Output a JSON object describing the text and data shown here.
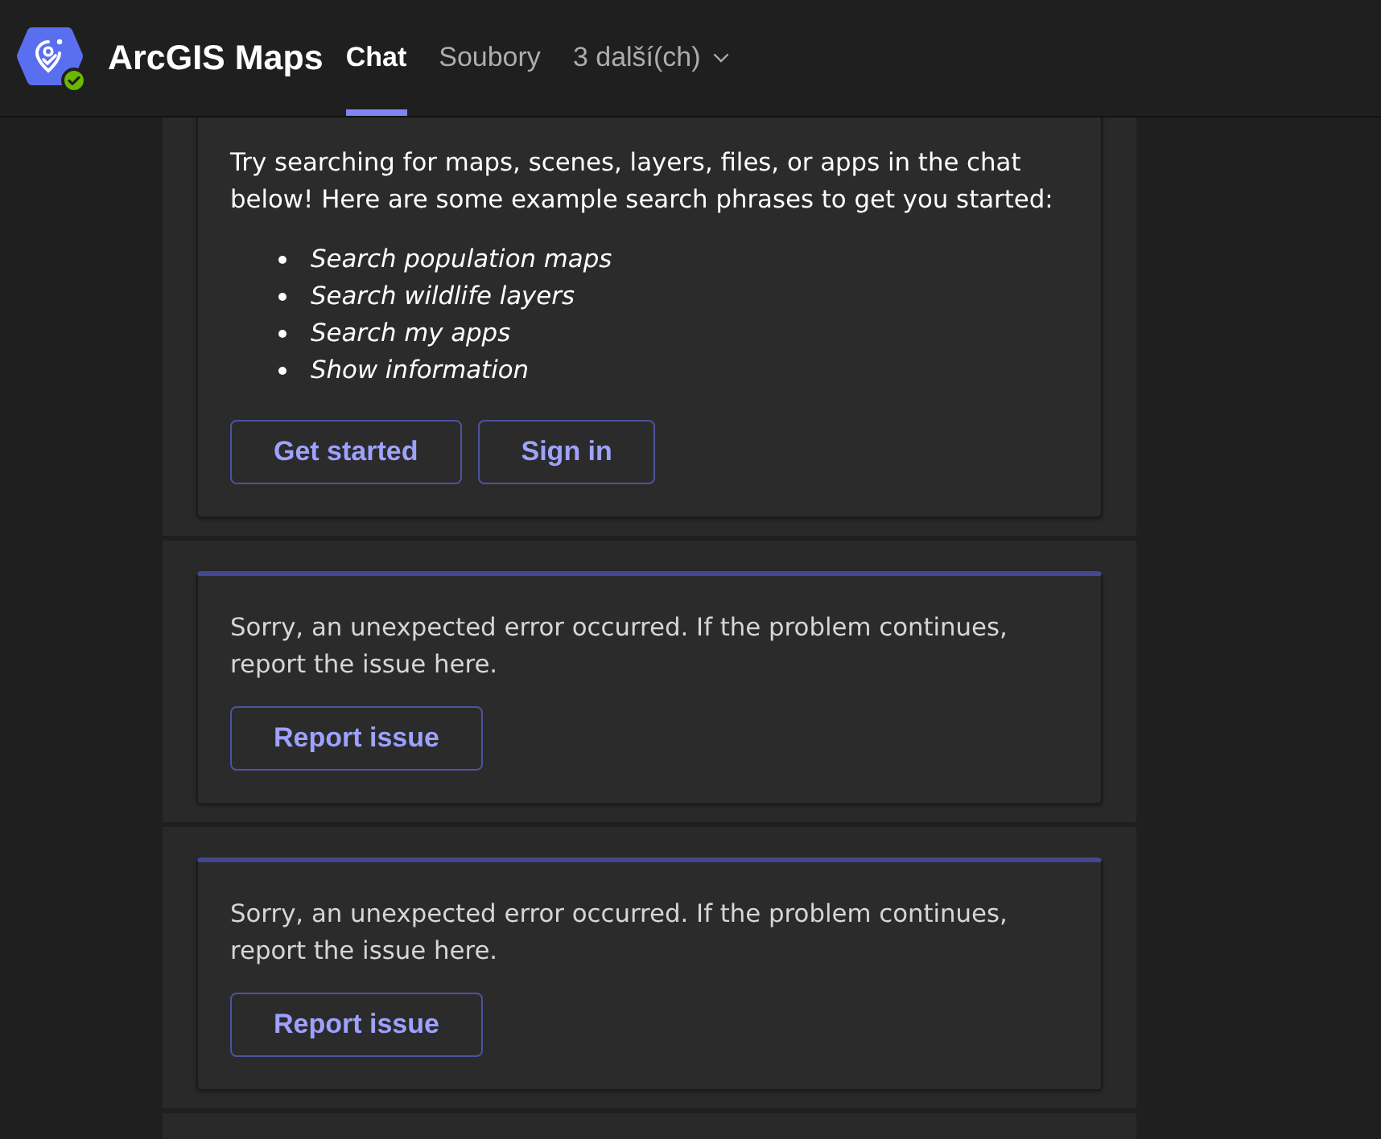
{
  "app": {
    "title": "ArcGIS Maps"
  },
  "tabs": [
    {
      "label": "Chat",
      "selected": true,
      "kind": "tab"
    },
    {
      "label": "Soubory",
      "selected": false,
      "kind": "tab"
    },
    {
      "label": "3 další(ch)",
      "selected": false,
      "kind": "menu"
    }
  ],
  "messages": [
    {
      "kind": "welcome",
      "text": "Try searching for maps, scenes, layers, files, or apps in the chat below! Here are some example search phrases to get you started:",
      "bullets": [
        "Search population maps",
        "Search wildlife layers",
        "Search my apps",
        "Show information"
      ],
      "buttons": [
        "Get started",
        "Sign in"
      ]
    },
    {
      "kind": "error",
      "text": "Sorry, an unexpected error occurred. If the problem continues, report the issue here.",
      "buttons": [
        "Report issue"
      ]
    },
    {
      "kind": "error",
      "text": "Sorry, an unexpected error occurred. If the problem continues, report the issue here.",
      "buttons": [
        "Report issue"
      ]
    }
  ]
}
